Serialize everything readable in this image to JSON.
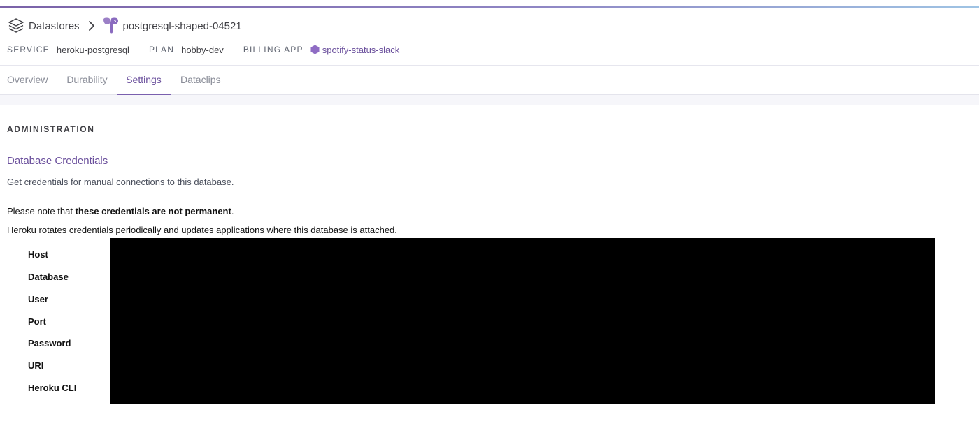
{
  "breadcrumb": {
    "root_label": "Datastores",
    "database_name": "postgresql-shaped-04521"
  },
  "meta": {
    "service_label": "SERVICE",
    "service_value": "heroku-postgresql",
    "plan_label": "PLAN",
    "plan_value": "hobby-dev",
    "billing_label": "BILLING APP",
    "billing_value": "spotify-status-slack"
  },
  "tabs": [
    {
      "label": "Overview",
      "active": false
    },
    {
      "label": "Durability",
      "active": false
    },
    {
      "label": "Settings",
      "active": true
    },
    {
      "label": "Dataclips",
      "active": false
    }
  ],
  "administration": {
    "section_title": "ADMINISTRATION",
    "credentials_title": "Database Credentials",
    "credentials_description": "Get credentials for manual connections to this database.",
    "note_prefix": "Please note that ",
    "note_bold": "these credentials are not permanent",
    "note_suffix": ".",
    "rotation_text": "Heroku rotates credentials periodically and updates applications where this database is attached.",
    "credential_labels": [
      "Host",
      "Database",
      "User",
      "Port",
      "Password",
      "URI",
      "Heroku CLI"
    ]
  },
  "colors": {
    "accent_purple": "#6a4f9c",
    "redaction": "#000000"
  },
  "icons": {
    "datastores": "layers-stack-icon",
    "breadcrumb_separator": "chevron-right-icon",
    "database": "postgres-elephant-icon",
    "billing_app": "hexagon-app-icon"
  }
}
